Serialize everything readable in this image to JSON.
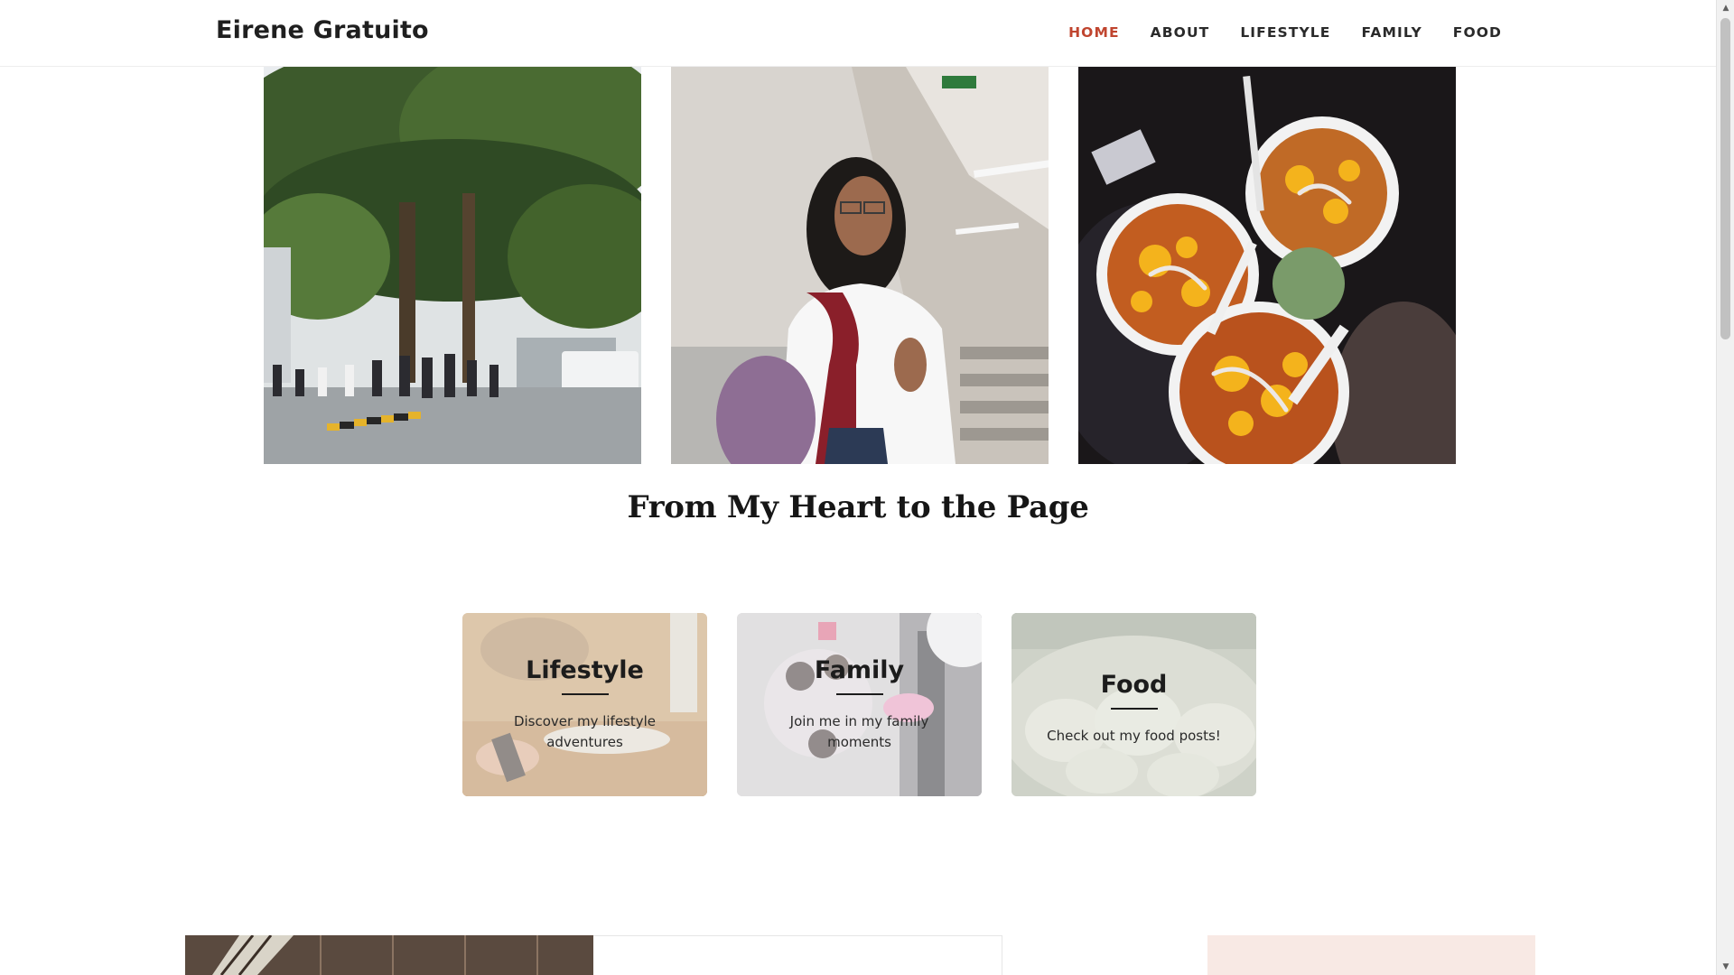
{
  "site": {
    "title": "Eirene Gratuito"
  },
  "nav": {
    "items": [
      {
        "label": "HOME",
        "active": true
      },
      {
        "label": "ABOUT",
        "active": false
      },
      {
        "label": "LIFESTYLE",
        "active": false
      },
      {
        "label": "FAMILY",
        "active": false
      },
      {
        "label": "FOOD",
        "active": false
      }
    ]
  },
  "section": {
    "title": "From My Heart to the Page"
  },
  "cards": [
    {
      "title": "Lifestyle",
      "description": "Discover my lifestyle adventures"
    },
    {
      "title": "Family",
      "description": "Join me in my family moments"
    },
    {
      "title": "Food",
      "description": "Check out my food posts!"
    }
  ],
  "colors": {
    "accent": "#c0452f",
    "text": "#222222",
    "pink_panel": "#f8e9e4"
  }
}
